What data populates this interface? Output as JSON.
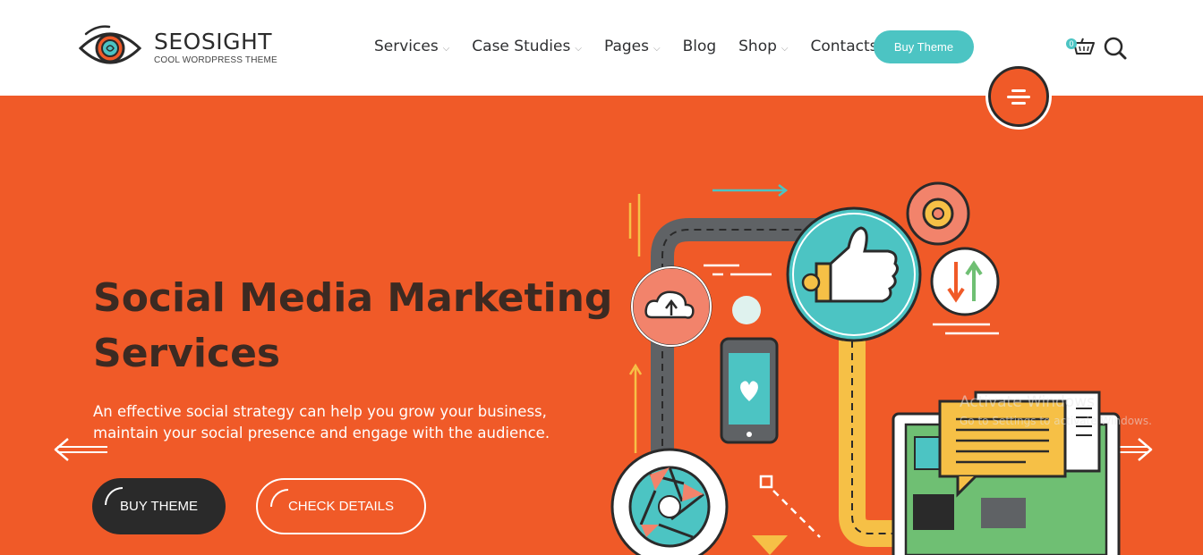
{
  "brand": {
    "name": "SEOSIGHT",
    "tagline": "COOL WORDPRESS THEME"
  },
  "nav": {
    "items": [
      {
        "label": "Services",
        "has_dropdown": true
      },
      {
        "label": "Case Studies",
        "has_dropdown": true
      },
      {
        "label": "Pages",
        "has_dropdown": true
      },
      {
        "label": "Blog",
        "has_dropdown": false
      },
      {
        "label": "Shop",
        "has_dropdown": true
      },
      {
        "label": "Contacts",
        "has_dropdown": false
      }
    ],
    "buy_label": "Buy Theme",
    "cart_count": "0"
  },
  "hero": {
    "title_line1": "Social Media Marketing",
    "title_line2": "Services",
    "desc_line1": "An effective social strategy can help you grow your business,",
    "desc_line2": "maintain your social presence and engage with the audience.",
    "primary_label": "BUY THEME",
    "secondary_label": "CHECK DETAILS"
  },
  "watermark": {
    "line1": "Activate Windows",
    "line2": "Go to Settings to activate Windows."
  },
  "colors": {
    "accent": "#f05a28",
    "teal": "#4cc4c3",
    "dark": "#2a2a2a",
    "text": "#3c2a22"
  },
  "icons": [
    "eye-logo-icon",
    "chevron-down-icon",
    "cart-icon",
    "search-icon",
    "menu-icon",
    "arrow-left-icon",
    "arrow-right-icon"
  ]
}
